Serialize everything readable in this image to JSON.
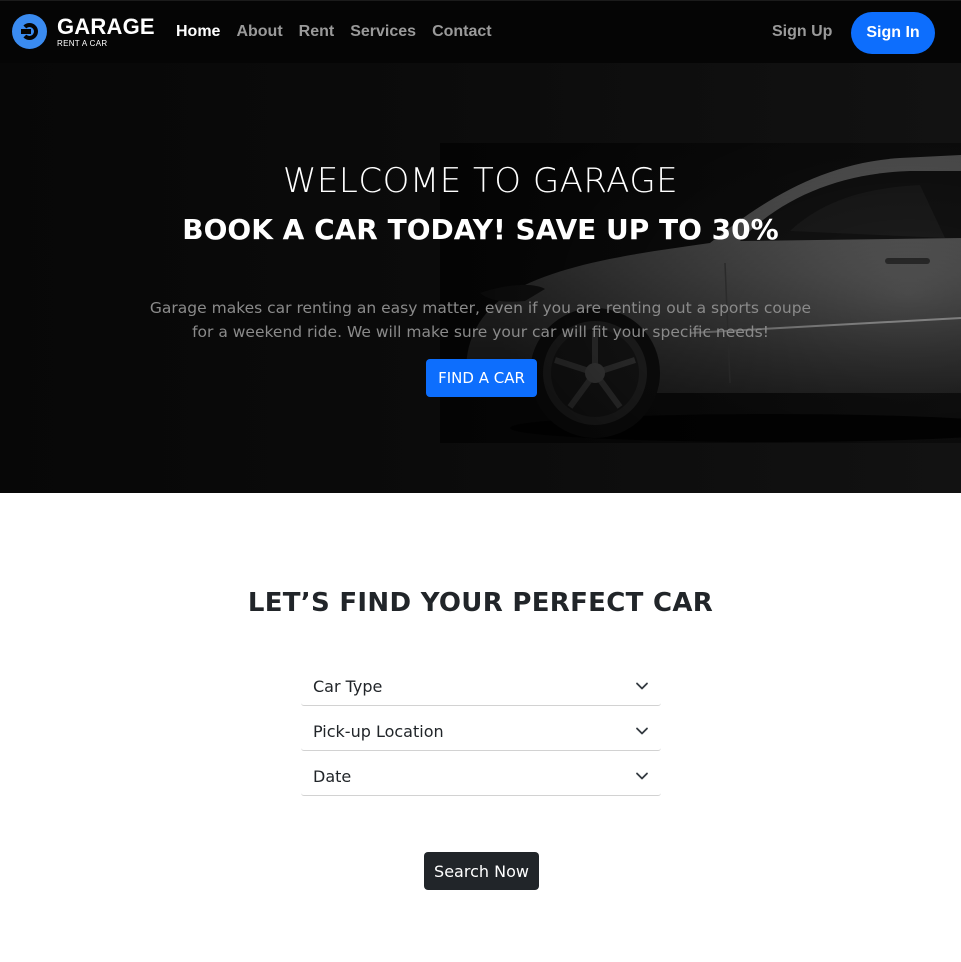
{
  "brand": {
    "name": "GARAGE",
    "tagline": "RENT A CAR",
    "accent": "#3a8bf0"
  },
  "nav": {
    "links": [
      {
        "label": "Home",
        "active": true
      },
      {
        "label": "About",
        "active": false
      },
      {
        "label": "Rent",
        "active": false
      },
      {
        "label": "Services",
        "active": false
      },
      {
        "label": "Contact",
        "active": false
      }
    ],
    "sign_up": "Sign Up",
    "sign_in": "Sign In"
  },
  "hero": {
    "title": "WELCOME TO GARAGE",
    "subtitle": "BOOK A CAR TODAY! SAVE UP TO 30%",
    "description": "Garage makes car renting an easy matter, even if you are renting out a sports coupe for a weekend ride. We will make sure your car will fit your specific needs!",
    "cta": "FIND A CAR"
  },
  "finder": {
    "title": "LET’S FIND YOUR PERFECT CAR",
    "selects": [
      {
        "label": "Car Type",
        "icon": "chevron-down-icon"
      },
      {
        "label": "Pick-up Location",
        "icon": "chevron-down-icon"
      },
      {
        "label": "Date",
        "icon": "chevron-down-icon"
      }
    ],
    "search": "Search Now"
  },
  "colors": {
    "primary": "#0d6efd",
    "dark": "#212529",
    "navbar": "#050505"
  }
}
